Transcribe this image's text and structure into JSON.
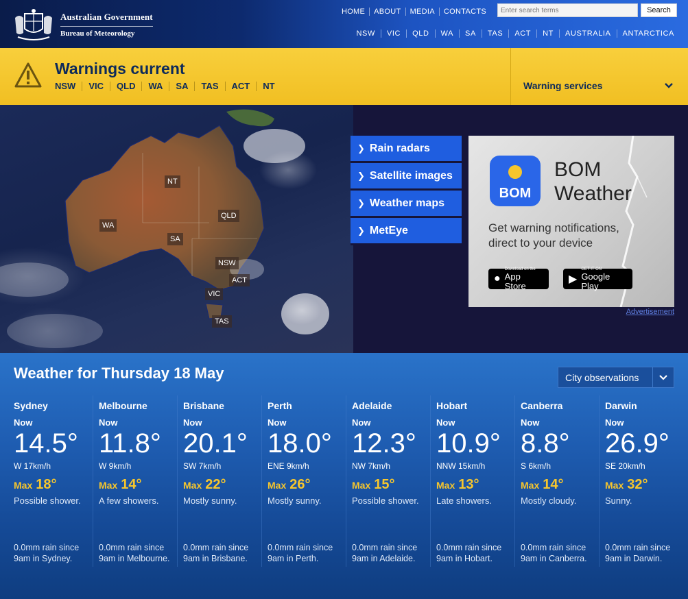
{
  "header": {
    "gov_line1": "Australian Government",
    "gov_line2": "Bureau of Meteorology",
    "top_links": [
      "HOME",
      "ABOUT",
      "MEDIA",
      "CONTACTS"
    ],
    "search_placeholder": "Enter search terms",
    "search_button": "Search",
    "state_links": [
      "NSW",
      "VIC",
      "QLD",
      "WA",
      "SA",
      "TAS",
      "ACT",
      "NT",
      "AUSTRALIA",
      "ANTARCTICA"
    ]
  },
  "warnings": {
    "title": "Warnings current",
    "states": [
      "NSW",
      "VIC",
      "QLD",
      "WA",
      "SA",
      "TAS",
      "ACT",
      "NT"
    ],
    "services_label": "Warning services",
    "accent_color": "#f6c62d"
  },
  "map": {
    "labels": [
      "NT",
      "WA",
      "QLD",
      "SA",
      "NSW",
      "ACT",
      "VIC",
      "TAS"
    ]
  },
  "quicklinks": [
    "Rain radars",
    "Satellite images",
    "Weather maps",
    "MetEye"
  ],
  "advert": {
    "app_icon_text": "BOM",
    "title_line1": "BOM",
    "title_line2": "Weather",
    "sub_line1": "Get warning notifications,",
    "sub_line2": "direct to your device",
    "appstore_small": "Download on the",
    "appstore_big": "App Store",
    "googleplay_small": "GET IT ON",
    "googleplay_big": "Google Play",
    "link": "Advertisement"
  },
  "weather": {
    "title": "Weather for Thursday 18 May",
    "select_value": "City observations",
    "now_label": "Now",
    "max_label": "Max",
    "cities": [
      {
        "name": "Sydney",
        "temp": "14.5°",
        "wind": "W 17km/h",
        "max": "18°",
        "forecast": "Possible shower.",
        "rain1": "0.0mm rain since",
        "rain2": "9am in Sydney."
      },
      {
        "name": "Melbourne",
        "temp": "11.8°",
        "wind": "W 9km/h",
        "max": "14°",
        "forecast": "A few showers.",
        "rain1": "0.0mm rain since",
        "rain2": "9am in Melbourne."
      },
      {
        "name": "Brisbane",
        "temp": "20.1°",
        "wind": "SW 7km/h",
        "max": "22°",
        "forecast": "Mostly sunny.",
        "rain1": "0.0mm rain since",
        "rain2": "9am in Brisbane."
      },
      {
        "name": "Perth",
        "temp": "18.0°",
        "wind": "ENE 9km/h",
        "max": "26°",
        "forecast": "Mostly sunny.",
        "rain1": "0.0mm rain since",
        "rain2": "9am in Perth."
      },
      {
        "name": "Adelaide",
        "temp": "12.3°",
        "wind": "NW 7km/h",
        "max": "15°",
        "forecast": "Possible shower.",
        "rain1": "0.0mm rain since",
        "rain2": "9am in Adelaide."
      },
      {
        "name": "Hobart",
        "temp": "10.9°",
        "wind": "NNW 15km/h",
        "max": "13°",
        "forecast": "Late showers.",
        "rain1": "0.0mm rain since",
        "rain2": "9am in Hobart."
      },
      {
        "name": "Canberra",
        "temp": "8.8°",
        "wind": "S 6km/h",
        "max": "14°",
        "forecast": "Mostly cloudy.",
        "rain1": "0.0mm rain since",
        "rain2": "9am in Canberra."
      },
      {
        "name": "Darwin",
        "temp": "26.9°",
        "wind": "SE 20km/h",
        "max": "32°",
        "forecast": "Sunny.",
        "rain1": "0.0mm rain since",
        "rain2": "9am in Darwin."
      }
    ]
  }
}
